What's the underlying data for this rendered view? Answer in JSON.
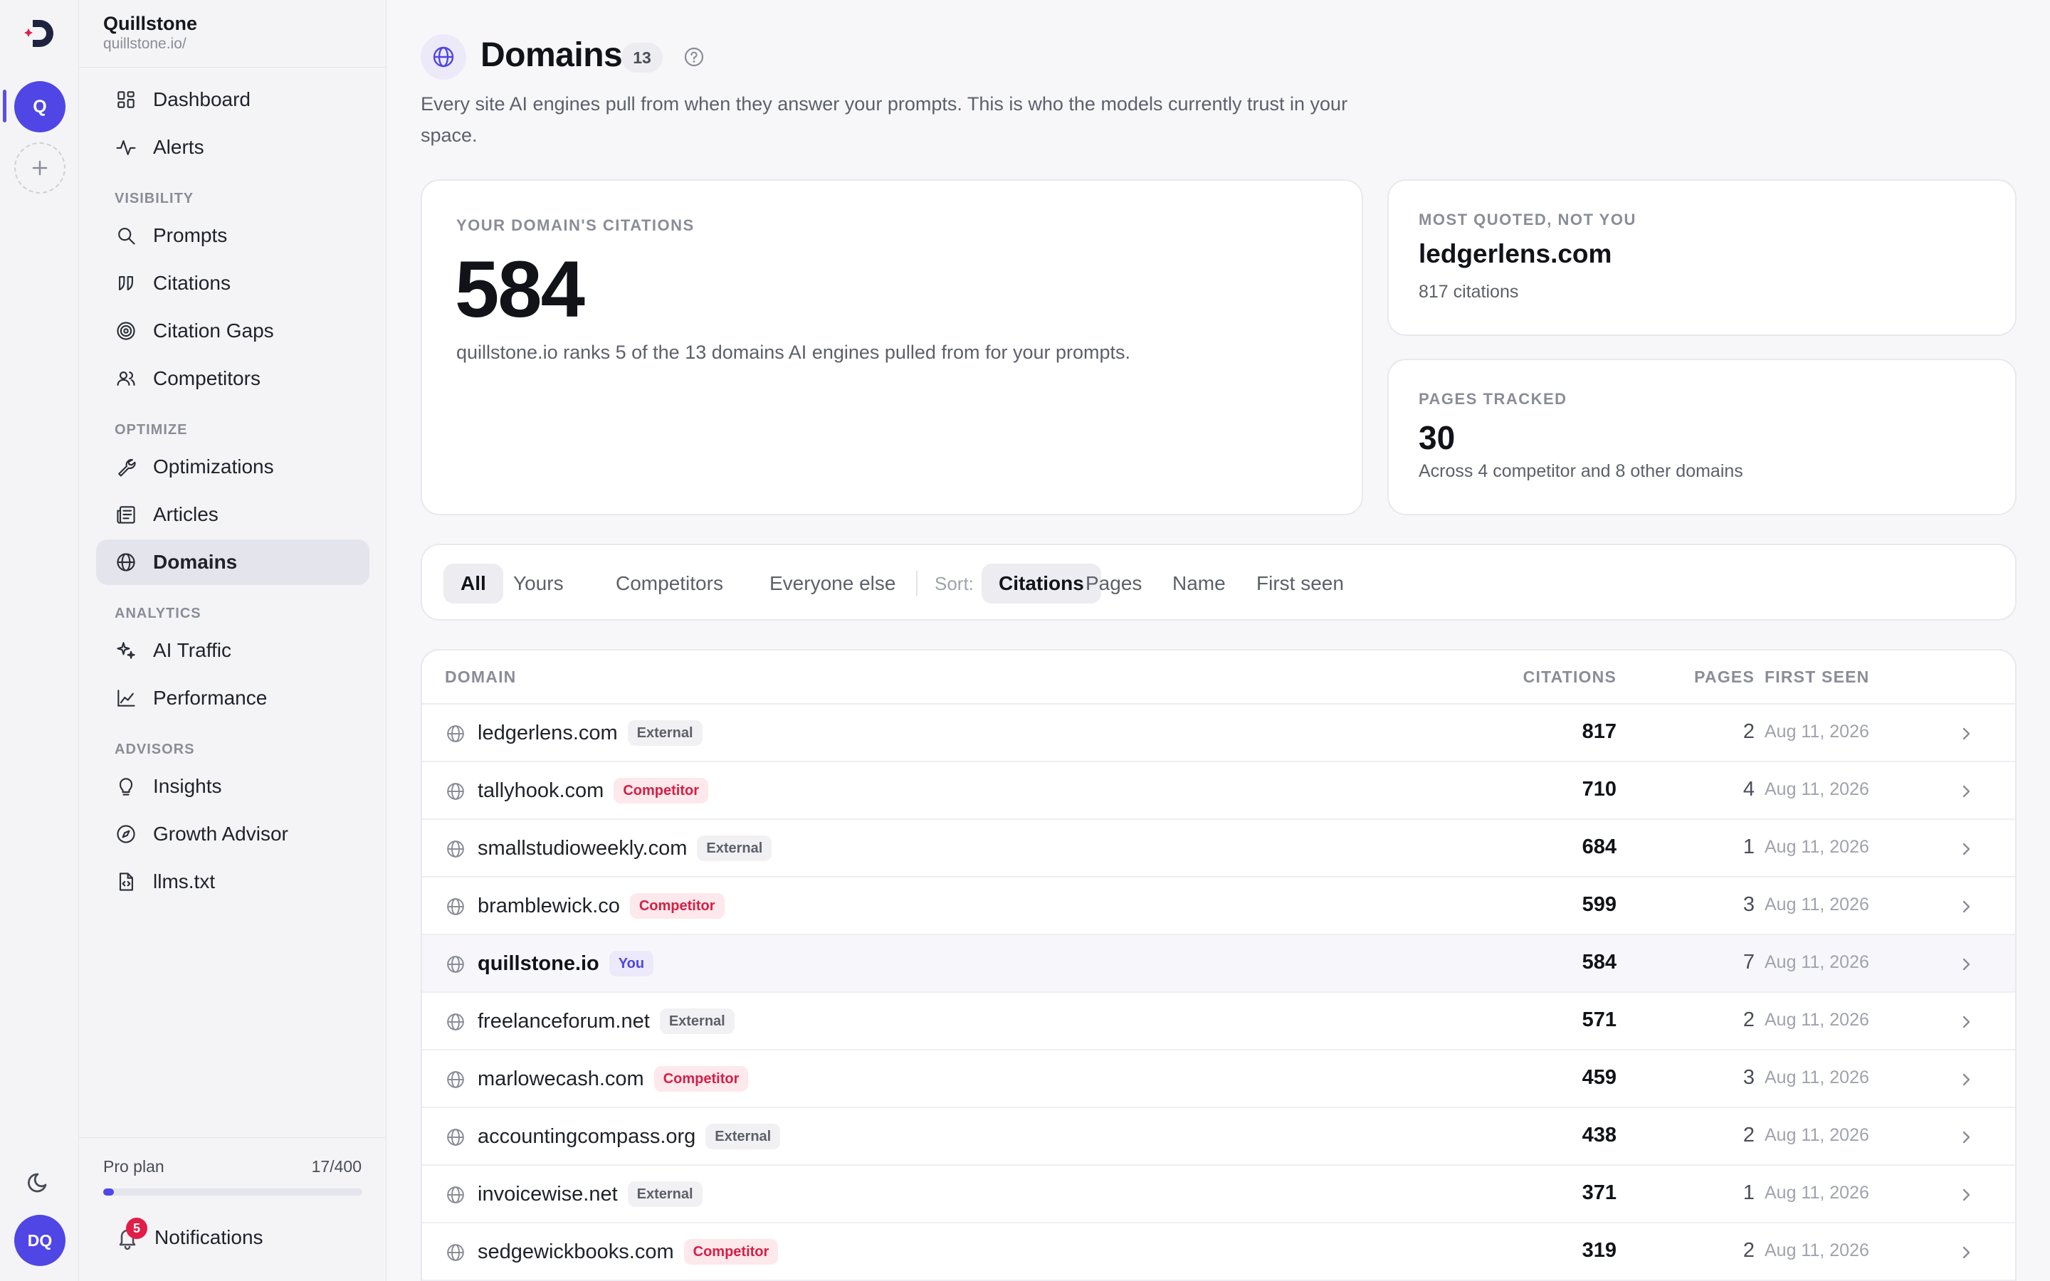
{
  "rail": {
    "workspace_initial": "Q",
    "user_initials": "DQ"
  },
  "workspace": {
    "name": "Quillstone",
    "url": "quillstone.io/"
  },
  "nav": {
    "top": [
      {
        "label": "Dashboard",
        "icon": "dashboard-icon"
      },
      {
        "label": "Alerts",
        "icon": "activity-icon"
      }
    ],
    "sections": [
      {
        "title": "VISIBILITY",
        "items": [
          {
            "label": "Prompts",
            "icon": "search-icon"
          },
          {
            "label": "Citations",
            "icon": "quote-icon"
          },
          {
            "label": "Citation Gaps",
            "icon": "target-icon"
          },
          {
            "label": "Competitors",
            "icon": "users-icon"
          }
        ]
      },
      {
        "title": "OPTIMIZE",
        "items": [
          {
            "label": "Optimizations",
            "icon": "wrench-icon"
          },
          {
            "label": "Articles",
            "icon": "newspaper-icon"
          },
          {
            "label": "Domains",
            "icon": "globe-icon",
            "active": true
          }
        ]
      },
      {
        "title": "ANALYTICS",
        "items": [
          {
            "label": "AI Traffic",
            "icon": "sparkles-icon"
          },
          {
            "label": "Performance",
            "icon": "chart-icon"
          }
        ]
      },
      {
        "title": "ADVISORS",
        "items": [
          {
            "label": "Insights",
            "icon": "lightbulb-icon"
          },
          {
            "label": "Growth Advisor",
            "icon": "compass-icon"
          },
          {
            "label": "llms.txt",
            "icon": "file-code-icon"
          }
        ]
      }
    ]
  },
  "plan": {
    "label": "Pro plan",
    "count": "17/400",
    "used_fraction": 0.0425
  },
  "notifications": {
    "label": "Notifications",
    "badge": "5"
  },
  "header": {
    "title": "Domains",
    "count": "13",
    "subtitle": "Every site AI engines pull from when they answer your prompts. This is who the models currently trust in your space."
  },
  "stats": {
    "citations": {
      "eyebrow": "YOUR DOMAIN'S CITATIONS",
      "value": "584",
      "desc": "quillstone.io ranks 5 of the 13 domains AI engines pulled from for your prompts."
    },
    "most_quoted": {
      "eyebrow": "MOST QUOTED, NOT YOU",
      "value": "ledgerlens.com",
      "sub": "817 citations"
    },
    "pages": {
      "eyebrow": "PAGES TRACKED",
      "value": "30",
      "sub": "Across 4 competitor and 8 other domains"
    }
  },
  "filters": {
    "chips": [
      "All",
      "Yours",
      "Competitors",
      "Everyone else"
    ],
    "sort_label": "Sort:",
    "sort_options": [
      "Citations",
      "Pages",
      "Name",
      "First seen"
    ]
  },
  "table": {
    "headers": {
      "domain": "DOMAIN",
      "citations": "CITATIONS",
      "pages": "PAGES",
      "first_seen": "FIRST SEEN"
    },
    "rows": [
      {
        "domain": "ledgerlens.com",
        "tag": "External",
        "kind": "ext",
        "citations": "817",
        "pages": "2",
        "first_seen": "Aug 11, 2026"
      },
      {
        "domain": "tallyhook.com",
        "tag": "Competitor",
        "kind": "comp",
        "citations": "710",
        "pages": "4",
        "first_seen": "Aug 11, 2026"
      },
      {
        "domain": "smallstudioweekly.com",
        "tag": "External",
        "kind": "ext",
        "citations": "684",
        "pages": "1",
        "first_seen": "Aug 11, 2026"
      },
      {
        "domain": "bramblewick.co",
        "tag": "Competitor",
        "kind": "comp",
        "citations": "599",
        "pages": "3",
        "first_seen": "Aug 11, 2026"
      },
      {
        "domain": "quillstone.io",
        "tag": "You",
        "kind": "you",
        "citations": "584",
        "pages": "7",
        "first_seen": "Aug 11, 2026"
      },
      {
        "domain": "freelanceforum.net",
        "tag": "External",
        "kind": "ext",
        "citations": "571",
        "pages": "2",
        "first_seen": "Aug 11, 2026"
      },
      {
        "domain": "marlowecash.com",
        "tag": "Competitor",
        "kind": "comp",
        "citations": "459",
        "pages": "3",
        "first_seen": "Aug 11, 2026"
      },
      {
        "domain": "accountingcompass.org",
        "tag": "External",
        "kind": "ext",
        "citations": "438",
        "pages": "2",
        "first_seen": "Aug 11, 2026"
      },
      {
        "domain": "invoicewise.net",
        "tag": "External",
        "kind": "ext",
        "citations": "371",
        "pages": "1",
        "first_seen": "Aug 11, 2026"
      },
      {
        "domain": "sedgewickbooks.com",
        "tag": "Competitor",
        "kind": "comp",
        "citations": "319",
        "pages": "2",
        "first_seen": "Aug 11, 2026"
      }
    ]
  },
  "colors": {
    "accent": "#4f46e5",
    "competitor": "#d61f45",
    "background": "#f7f7f9"
  }
}
